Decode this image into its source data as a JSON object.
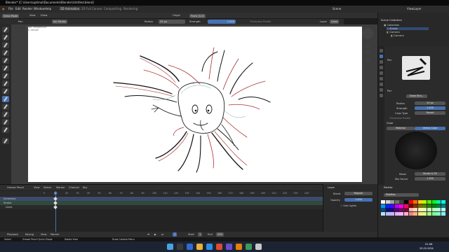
{
  "window": {
    "title": "Blender* [C:\\Users\\optimal\\Documents\\Blender\\Untitled.blend]",
    "min": "—",
    "max": "☐",
    "close": "✕"
  },
  "menu": {
    "items": [
      "File",
      "Edit",
      "Render",
      "Window",
      "Help"
    ],
    "workspace_tabs": [
      "2D Animation",
      "2D Full Canvas",
      "Compositing",
      "Rendering"
    ],
    "scene": "Scene",
    "view_layer": "ViewLayer"
  },
  "header": {
    "mode": "Draw Mode",
    "view": "View",
    "draw": "Draw",
    "origin": "Origin",
    "placement": "Front (X-Z)"
  },
  "tool_settings": {
    "brush": "Pen",
    "material": "Ink Stroke",
    "radius_label": "Radius",
    "radius_value": "20 px",
    "strength_label": "Strength",
    "strength_value": "1.000",
    "thickness_label": "Thickness Profile",
    "layer_label": "Layer",
    "layer_value": "Lines"
  },
  "viewport": {
    "info_line1": "User Perspective",
    "info_line2": "(1) Stroke"
  },
  "outliner": {
    "title": "Scene Collection",
    "rows": [
      "Collection",
      "Stroke",
      "Camera",
      "Camera"
    ]
  },
  "properties": {
    "brush_name": "Pen",
    "brush_asset": "Draw Stro...",
    "radius_label": "Radius",
    "radius_value": "20 px",
    "strength_label": "Strength",
    "strength_value": "1.000",
    "caps_label": "Caps Type",
    "caps_value": "Round",
    "thickness_label": "Thickness Profile",
    "color_section": "Color",
    "material_tab": "Material",
    "vertex_tab": "Vertex Color",
    "mode_label": "Mode",
    "mode_value": "Stroke & Fill",
    "mix_label": "Mix Factor",
    "mix_value": "1.000",
    "palette_section": "Palette",
    "palette_name": "Palettes"
  },
  "timeline": {
    "header_items": [
      "Grease Pencil",
      "View",
      "Select",
      "Marker",
      "Channel",
      "Key"
    ],
    "frames": [
      "0",
      "10",
      "20",
      "30",
      "40",
      "50",
      "60",
      "70",
      "80",
      "90",
      "100",
      "110",
      "120",
      "130",
      "140",
      "150",
      "160",
      "170",
      "180",
      "190",
      "200",
      "210",
      "220",
      "230",
      "240"
    ],
    "current_frame": "1",
    "tracks": [
      "Summary",
      "Stroke",
      "Lines"
    ],
    "layer_panel": {
      "title": "Layer",
      "blend_label": "Blend",
      "blend_value": "Regular",
      "opacity_label": "Opacity",
      "opacity_value": "1.000",
      "lights_label": "Use Lights"
    },
    "playback": [
      "Playback",
      "Keying",
      "View",
      "Marker"
    ],
    "start_label": "Start",
    "start_value": "1",
    "end_label": "End",
    "end_value": "250"
  },
  "statusbar": {
    "left": "Select",
    "middle": "Grease Pencil Quick Shape",
    "middle2": "Rotate View",
    "right": "Draw Context Menu"
  },
  "taskbar": {
    "time": "01:08",
    "date": "25-05-2024"
  },
  "colors": {
    "accent": "#4772b3",
    "summary_track": "#3e4a6b",
    "stroke_track": "#2f4a3a"
  }
}
